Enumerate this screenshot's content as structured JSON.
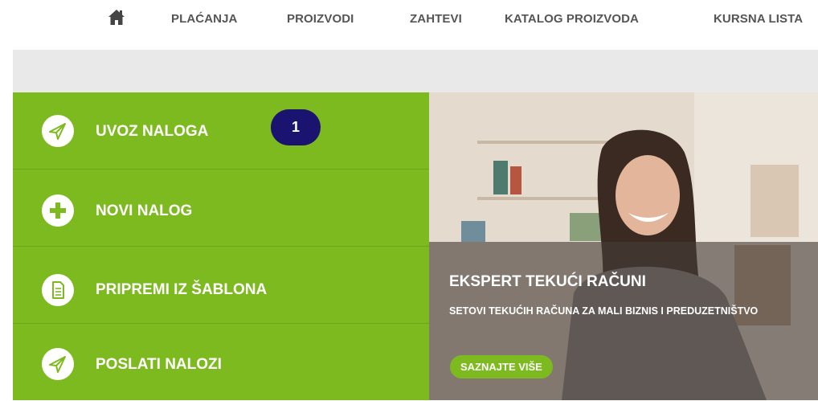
{
  "nav": {
    "home_icon": "home-icon",
    "items": [
      "PLAĆANJA",
      "PROIZVODI",
      "ZAHTEVI",
      "KATALOG PROIZVODA",
      "KURSNA LISTA"
    ]
  },
  "menu": {
    "items": [
      {
        "label": "UVOZ NALOGA",
        "icon": "paper-plane-icon"
      },
      {
        "label": "NOVI NALOG",
        "icon": "plus-icon"
      },
      {
        "label": "PRIPREMI IZ ŠABLONA",
        "icon": "document-icon"
      },
      {
        "label": "POSLATI NALOZI",
        "icon": "paper-plane-icon"
      }
    ],
    "badge": "1"
  },
  "banner": {
    "title": "EKSPERT TEKUĆI RAČUNI",
    "subtitle": "SETOVI TEKUĆIH RAČUNA ZA MALI BIZNIS I PREDUZETNIŠTVO",
    "button": "SAZNAJTE VIŠE"
  },
  "colors": {
    "green": "#7dba1f",
    "badge": "#1a1470",
    "nav_text": "#555555",
    "grey_bar": "#e9e9ea"
  }
}
